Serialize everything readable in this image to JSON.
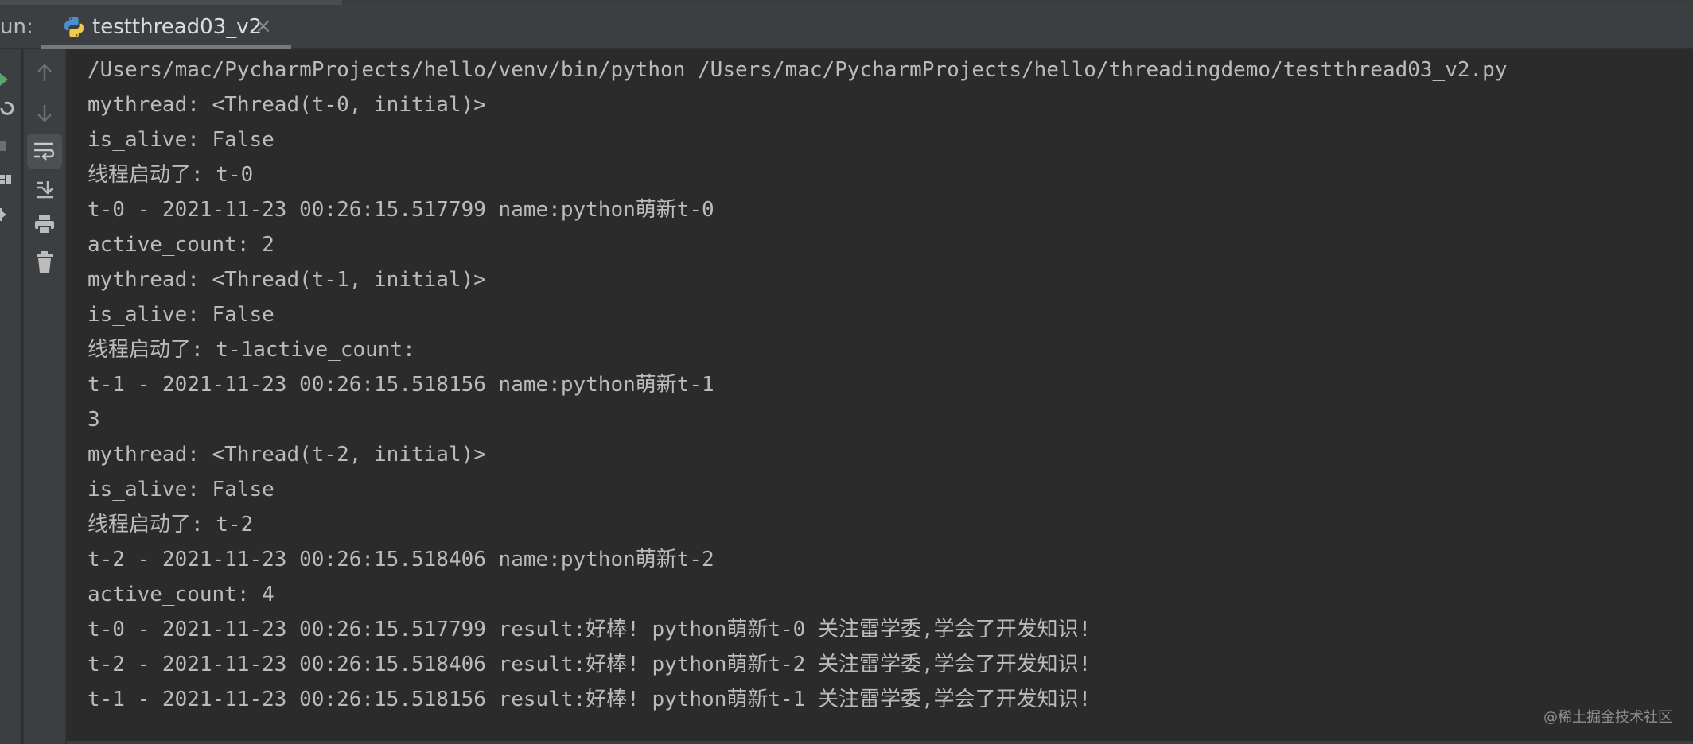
{
  "run_panel": {
    "run_label": "un:",
    "tab": {
      "title": "testthread03_v2",
      "close": "×",
      "icon": "python-icon"
    }
  },
  "toolbar": {
    "items": [
      {
        "name": "up-arrow-icon"
      },
      {
        "name": "down-arrow-icon"
      },
      {
        "name": "soft-wrap-icon",
        "active": true
      },
      {
        "name": "scroll-to-end-icon"
      },
      {
        "name": "print-icon"
      },
      {
        "name": "trash-icon"
      }
    ]
  },
  "console": {
    "lines": [
      "/Users/mac/PycharmProjects/hello/venv/bin/python /Users/mac/PycharmProjects/hello/threadingdemo/testthread03_v2.py",
      "mythread: <Thread(t-0, initial)>",
      "is_alive: False",
      "线程启动了: t-0",
      "t-0 - 2021-11-23 00:26:15.517799 name:python萌新t-0",
      "active_count: 2",
      "mythread: <Thread(t-1, initial)>",
      "is_alive: False",
      "线程启动了: t-1active_count:",
      "t-1 - 2021-11-23 00:26:15.518156 name:python萌新t-1",
      "3",
      "mythread: <Thread(t-2, initial)>",
      "is_alive: False",
      "线程启动了: t-2",
      "t-2 - 2021-11-23 00:26:15.518406 name:python萌新t-2",
      "active_count: 4",
      "t-0 - 2021-11-23 00:26:15.517799 result:好棒! python萌新t-0 关注雷学委,学会了开发知识!",
      "t-2 - 2021-11-23 00:26:15.518406 result:好棒! python萌新t-2 关注雷学委,学会了开发知识!",
      "t-1 - 2021-11-23 00:26:15.518156 result:好棒! python萌新t-1 关注雷学委,学会了开发知识!"
    ]
  },
  "watermark": "@稀土掘金技术社区",
  "colors": {
    "background": "#2b2b2b",
    "panel": "#3c3f41",
    "text": "#bbbbbb",
    "run_green": "#59a869"
  }
}
